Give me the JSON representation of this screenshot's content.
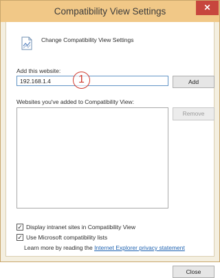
{
  "window": {
    "title": "Compatibility View Settings",
    "close_glyph": "✕"
  },
  "header": {
    "text": "Change Compatibility View Settings",
    "icon": "compatibility-page-icon"
  },
  "add_site": {
    "label": "Add this website:",
    "value": "192.168.1.4",
    "add_button": "Add"
  },
  "annotation": {
    "number": "1"
  },
  "site_list": {
    "label": "Websites you've added to Compatibility View:",
    "remove_button": "Remove"
  },
  "options": [
    {
      "label": "Display intranet sites in Compatibility View",
      "checked": true
    },
    {
      "label": "Use Microsoft compatibility lists",
      "checked": true
    }
  ],
  "learn_more": {
    "prefix": "Learn more by reading the ",
    "link": "Internet Explorer privacy statement"
  },
  "footer": {
    "close_button": "Close"
  },
  "colors": {
    "titlebar": "#f1c887",
    "close": "#c7463d",
    "link": "#1d61b0",
    "annotation": "#d03a2f",
    "input_border": "#5f93c5"
  }
}
